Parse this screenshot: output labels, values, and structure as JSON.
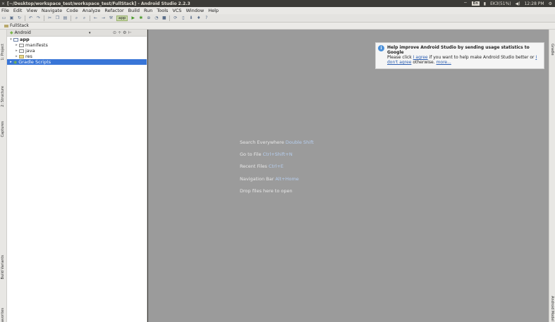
{
  "window": {
    "title": "[~/Desktop/workspace_test/workspace_test/FullStack] - Android Studio 2.2.3",
    "close_glyph": "×",
    "tray": {
      "keyboard": "En",
      "battery": "EK3(51%)",
      "time": "12:28 PM"
    }
  },
  "menu": {
    "items": [
      "File",
      "Edit",
      "View",
      "Navigate",
      "Code",
      "Analyze",
      "Refactor",
      "Build",
      "Run",
      "Tools",
      "VCS",
      "Window",
      "Help"
    ]
  },
  "toolbar": {
    "run_config": "app"
  },
  "breadcrumb": {
    "project": "FullStack"
  },
  "left_strip": {
    "tabs": [
      "1: Project",
      "2: Structure",
      "Captures",
      "Build Variants",
      "Favorites"
    ]
  },
  "right_strip": {
    "tabs": [
      "Gradle",
      "Android Model"
    ]
  },
  "project_panel": {
    "view_mode": "Android",
    "tree": [
      {
        "label": "app",
        "level": 0,
        "expanded": true,
        "icon": "module-icon"
      },
      {
        "label": "manifests",
        "level": 1,
        "expanded": false,
        "icon": "folder-icon"
      },
      {
        "label": "java",
        "level": 1,
        "expanded": false,
        "icon": "folder-icon"
      },
      {
        "label": "res",
        "level": 1,
        "expanded": false,
        "icon": "res-folder-icon"
      },
      {
        "label": "Gradle Scripts",
        "level": 0,
        "expanded": false,
        "icon": "gradle-icon",
        "selected": true
      }
    ]
  },
  "editor": {
    "hints": [
      {
        "text": "Search Everywhere",
        "shortcut": "Double Shift"
      },
      {
        "text": "Go to File",
        "shortcut": "Ctrl+Shift+N"
      },
      {
        "text": "Recent Files",
        "shortcut": "Ctrl+E"
      },
      {
        "text": "Navigation Bar",
        "shortcut": "Alt+Home"
      },
      {
        "text": "Drop files here to open",
        "shortcut": ""
      }
    ]
  },
  "notification": {
    "title": "Help improve Android Studio by sending usage statistics to Google",
    "body_prefix": "Please click",
    "agree": "I agree",
    "body_mid": "if you want to help make Android Studio better or",
    "disagree": "I don't agree",
    "body_suffix": "otherwise.",
    "more": "more..."
  }
}
